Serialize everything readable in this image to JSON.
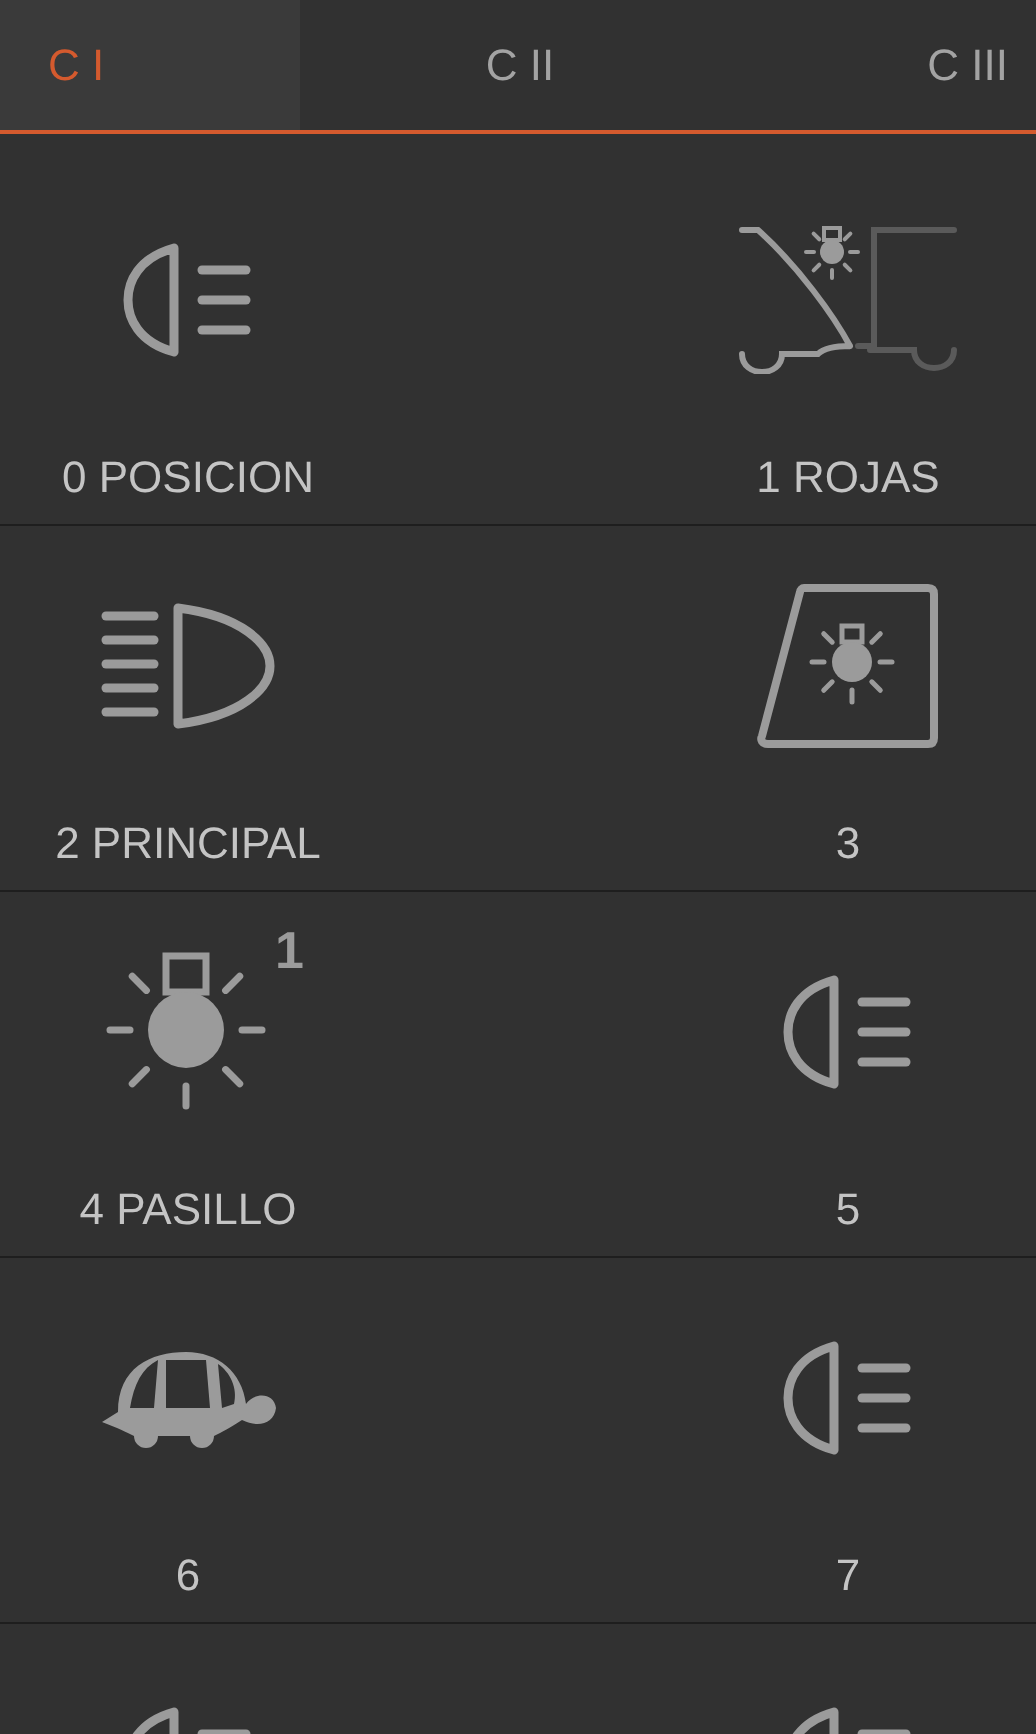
{
  "tabs": [
    {
      "label": "C I",
      "selected": true
    },
    {
      "label": "C II",
      "selected": false
    },
    {
      "label": "C III",
      "selected": false
    }
  ],
  "items": [
    {
      "kind": "position",
      "label": "0 POSICION"
    },
    {
      "kind": "trailer",
      "label": "1 ROJAS"
    },
    {
      "kind": "main-beam",
      "label": "2 PRINCIPAL"
    },
    {
      "kind": "roof-lamp",
      "label": "3"
    },
    {
      "kind": "bulb",
      "label": "4 PASILLO",
      "badge": "1"
    },
    {
      "kind": "position",
      "label": "5"
    },
    {
      "kind": "turtle",
      "label": "6"
    },
    {
      "kind": "position",
      "label": "7"
    },
    {
      "kind": "position"
    },
    {
      "kind": "position"
    }
  ]
}
